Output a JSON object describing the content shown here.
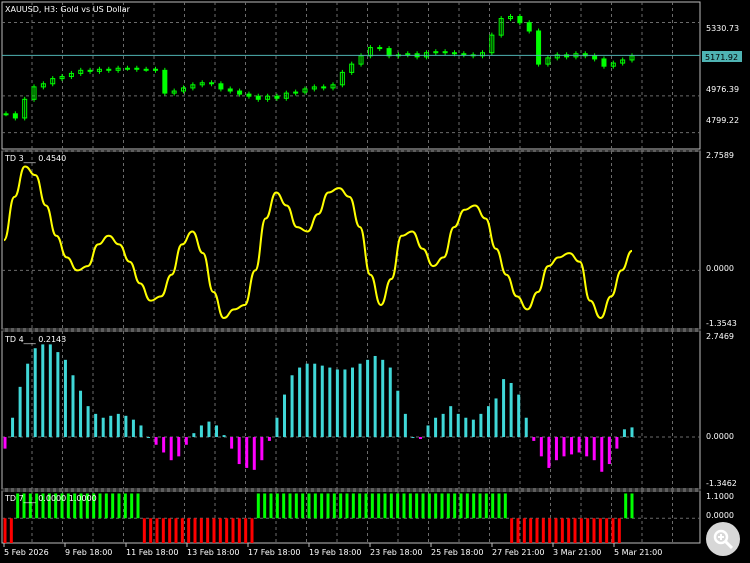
{
  "chart_data": [
    {
      "type": "candlestick",
      "title": "XAUUSD, H3:  Gold vs US Dollar",
      "ylim": [
        4720,
        5430
      ],
      "yticks": [
        "5330.73",
        "4976.39",
        "4799.22"
      ],
      "ytick_values": [
        5330.73,
        4976.39,
        4799.22
      ],
      "current_price_label": "5171.92",
      "current_price": 5171.92,
      "colors": {
        "up": "#00ff00",
        "down": "#00ff00",
        "price_line": "#4fb3b3",
        "price_label_bg": "#4fb3b3"
      },
      "close": [
        4890,
        4870,
        4960,
        5020,
        5035,
        5060,
        5070,
        5085,
        5100,
        5095,
        5105,
        5100,
        5110,
        5110,
        5105,
        5105,
        5100,
        4990,
        5000,
        5015,
        5030,
        5040,
        5035,
        5010,
        5000,
        4985,
        4975,
        4960,
        4975,
        4965,
        4990,
        4995,
        5010,
        5020,
        5015,
        5030,
        5090,
        5130,
        5170,
        5210,
        5205,
        5170,
        5175,
        5180,
        5165,
        5185,
        5190,
        5185,
        5180,
        5175,
        5170,
        5185,
        5270,
        5350,
        5360,
        5330,
        5290,
        5130,
        5160,
        5175,
        5165,
        5180,
        5170,
        5155,
        5120,
        5135,
        5150,
        5170
      ]
    },
    {
      "type": "line",
      "label": "TD 3___ 0.4540",
      "ylim": [
        -1.3543,
        2.7589
      ],
      "yticks": [
        "2.7589",
        "0.0000",
        "-1.3543"
      ],
      "ytick_values": [
        2.7589,
        0.0,
        -1.3543
      ],
      "color": "#ffff00",
      "values": [
        0.7,
        1.7,
        2.4,
        2.2,
        1.5,
        0.8,
        0.3,
        0.0,
        0.1,
        0.6,
        0.8,
        0.6,
        0.2,
        -0.3,
        -0.7,
        -0.6,
        -0.1,
        0.6,
        0.9,
        0.4,
        -0.5,
        -1.1,
        -0.9,
        -0.8,
        0.0,
        1.2,
        1.8,
        1.5,
        1.0,
        0.9,
        1.3,
        1.8,
        1.9,
        1.7,
        1.0,
        -0.1,
        -0.8,
        -0.2,
        0.8,
        0.9,
        0.5,
        0.1,
        0.3,
        1.0,
        1.4,
        1.5,
        1.2,
        0.5,
        -0.1,
        -0.6,
        -0.9,
        -0.5,
        0.1,
        0.3,
        0.4,
        0.2,
        -0.7,
        -1.1,
        -0.6,
        0.0,
        0.45
      ]
    },
    {
      "type": "histogram",
      "label": "TD 4___ 0.2143",
      "ylim": [
        -1.3462,
        2.7469
      ],
      "yticks": [
        "2.7469",
        "0.0000",
        "-1.3462"
      ],
      "ytick_values": [
        2.7469,
        0.0,
        -1.3462
      ],
      "colors": {
        "positive": "#40d8d8",
        "negative": "#ff00ff"
      },
      "values": [
        -0.3,
        0.5,
        1.3,
        1.9,
        2.3,
        2.4,
        2.4,
        2.2,
        2.0,
        1.6,
        1.2,
        0.8,
        0.6,
        0.5,
        0.55,
        0.6,
        0.55,
        0.45,
        0.3,
        0.0,
        -0.2,
        -0.4,
        -0.6,
        -0.5,
        -0.2,
        0.1,
        0.3,
        0.4,
        0.3,
        0.05,
        -0.3,
        -0.7,
        -0.8,
        -0.85,
        -0.6,
        -0.1,
        0.5,
        1.1,
        1.6,
        1.8,
        1.9,
        1.9,
        1.85,
        1.8,
        1.75,
        1.75,
        1.8,
        1.9,
        2.0,
        2.1,
        2.0,
        1.8,
        1.2,
        0.6,
        0.0,
        -0.05,
        0.3,
        0.5,
        0.6,
        0.8,
        0.6,
        0.5,
        0.45,
        0.6,
        0.8,
        1.0,
        1.5,
        1.4,
        1.1,
        0.5,
        -0.1,
        -0.5,
        -0.8,
        -0.6,
        -0.5,
        -0.45,
        -0.4,
        -0.5,
        -0.6,
        -0.9,
        -0.7,
        -0.3,
        0.2,
        0.25
      ]
    },
    {
      "type": "histogram",
      "label": "TD 7___ 0.0000 1.0000",
      "ylim": [
        -1.0,
        1.1
      ],
      "yticks": [
        "1.1000",
        "0.0000"
      ],
      "ytick_values": [
        1.1,
        0.0
      ],
      "colors": {
        "positive": "#00ff00",
        "negative": "#ff0000"
      },
      "series": [
        {
          "values": [
            -1,
            -1,
            1,
            1,
            1,
            1,
            1,
            1,
            1,
            1,
            1,
            1,
            1,
            1,
            1,
            1,
            1,
            1,
            1,
            1,
            1,
            1,
            -1,
            -1,
            -1,
            -1,
            -1,
            -1,
            -1,
            -1,
            -1,
            -1,
            -1,
            -1,
            -1,
            -1,
            -1,
            -1,
            -1,
            -1,
            1,
            1,
            1,
            1,
            1,
            1,
            1,
            1,
            1,
            1,
            1,
            1,
            1,
            1,
            1,
            1,
            1,
            1,
            1,
            1,
            1,
            1,
            1,
            1,
            1,
            1,
            1,
            1,
            1,
            1,
            1,
            1,
            1,
            1,
            1,
            1,
            1,
            1,
            1,
            1,
            -1,
            -1,
            -1,
            -1,
            -1,
            -1,
            -1,
            -1,
            -1,
            -1,
            -1,
            -1,
            -1,
            -1,
            -1,
            -1,
            -1,
            -1,
            1,
            1
          ]
        }
      ],
      "x_date_labels": [
        "5 Feb 2026",
        "9 Feb 18:00",
        "11 Feb 18:00",
        "13 Feb 18:00",
        "17 Feb 18:00",
        "19 Feb 18:00",
        "23 Feb 18:00",
        "25 Feb 18:00",
        "27 Feb 21:00",
        "3 Mar 21:00",
        "5 Mar 21:00"
      ]
    }
  ]
}
